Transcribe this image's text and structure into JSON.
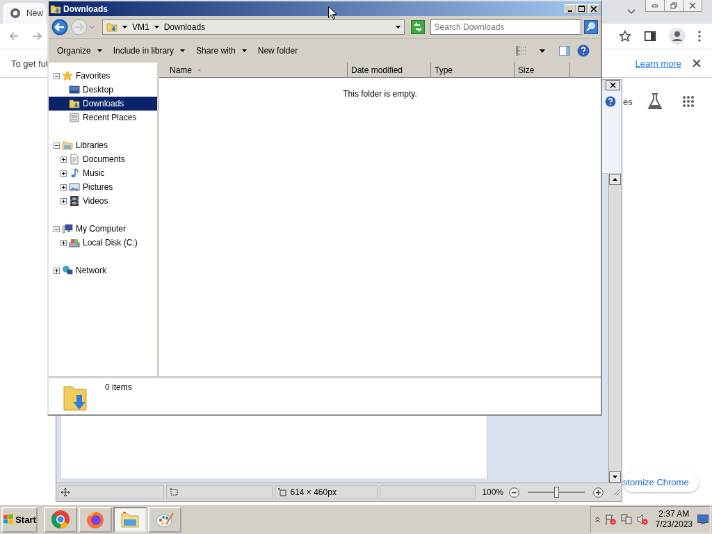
{
  "browser": {
    "tab_title": "New",
    "infobar_text": "To get fut",
    "learn_more_link": "Learn more",
    "side_text": "es",
    "customize_button": "stomize Chrome"
  },
  "paint": {
    "canvas_size": "614 × 460px",
    "zoom": "100%",
    "zoom_slider": {
      "level": 0.5
    }
  },
  "explorer": {
    "title": "Downloads",
    "path": [
      "VM1",
      "Downloads"
    ],
    "search": {
      "placeholder": "Search Downloads"
    },
    "toolbar": [
      {
        "label": "Organize",
        "has_menu": true
      },
      {
        "label": "Include in library",
        "has_menu": true
      },
      {
        "label": "Share with",
        "has_menu": true
      },
      {
        "label": "New folder",
        "has_menu": false
      }
    ],
    "columns": [
      {
        "label": "Name",
        "sorted": true
      },
      {
        "label": "Date modified",
        "sorted": false
      },
      {
        "label": "Type",
        "sorted": false
      },
      {
        "label": "Size",
        "sorted": false
      }
    ],
    "empty_message": "This folder is empty.",
    "nav": [
      {
        "label": "Favorites",
        "kind": "favorites",
        "expanded": true,
        "selected": false,
        "children": [
          {
            "label": "Desktop",
            "kind": "desktop",
            "selected": false
          },
          {
            "label": "Downloads",
            "kind": "downloads",
            "selected": true
          },
          {
            "label": "Recent Places",
            "kind": "recent",
            "selected": false
          }
        ]
      },
      {
        "label": "Libraries",
        "kind": "libraries",
        "expanded": true,
        "selected": false,
        "children": [
          {
            "label": "Documents",
            "kind": "documents",
            "expanded": false,
            "selected": false
          },
          {
            "label": "Music",
            "kind": "music",
            "expanded": false,
            "selected": false
          },
          {
            "label": "Pictures",
            "kind": "pictures",
            "expanded": false,
            "selected": false
          },
          {
            "label": "Videos",
            "kind": "videos",
            "expanded": false,
            "selected": false
          }
        ]
      },
      {
        "label": "My Computer",
        "kind": "computer",
        "expanded": true,
        "selected": false,
        "children": [
          {
            "label": "Local Disk (C:)",
            "kind": "disk",
            "expanded": false,
            "selected": false
          }
        ]
      },
      {
        "label": "Network",
        "kind": "network",
        "expanded": false,
        "selected": false
      }
    ],
    "status": "0 items"
  },
  "taskbar": {
    "start": "Start",
    "apps": [
      {
        "kind": "chrome",
        "selected": false
      },
      {
        "kind": "firefox",
        "selected": false
      },
      {
        "kind": "explorer",
        "selected": true
      },
      {
        "kind": "paint",
        "selected": false
      }
    ],
    "time": "2:37 AM",
    "date": "7/23/2023"
  }
}
